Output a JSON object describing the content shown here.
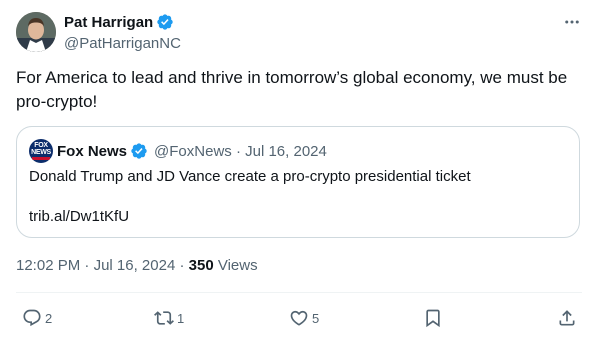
{
  "tweet": {
    "author_name": "Pat Harrigan",
    "author_handle": "@PatHarriganNC",
    "text": "For America to lead and thrive in tomorrow’s global economy, we must be pro-crypto!",
    "time": "12:02 PM",
    "date": "Jul 16, 2024",
    "views_count": "350",
    "views_label": "Views",
    "meta_separator": "·"
  },
  "quote": {
    "author_name": "Fox News",
    "author_handle": "@FoxNews",
    "separator": "·",
    "date": "Jul 16, 2024",
    "text": "Donald Trump and JD Vance create a pro-crypto presidential ticket",
    "link": "trib.al/Dw1tKfU",
    "logo_text": "FOX NEWS"
  },
  "actions": {
    "replies": "2",
    "reposts": "1",
    "likes": "5",
    "icons": [
      "reply-icon",
      "repost-icon",
      "like-icon",
      "bookmark-icon",
      "share-icon"
    ]
  },
  "colors": {
    "verified": "#1d9bf0",
    "secondary_text": "#536471",
    "primary_text": "#0f1419",
    "border": "#cfd9de",
    "fox_blue": "#0c2d6b",
    "fox_red": "#c8102e"
  }
}
